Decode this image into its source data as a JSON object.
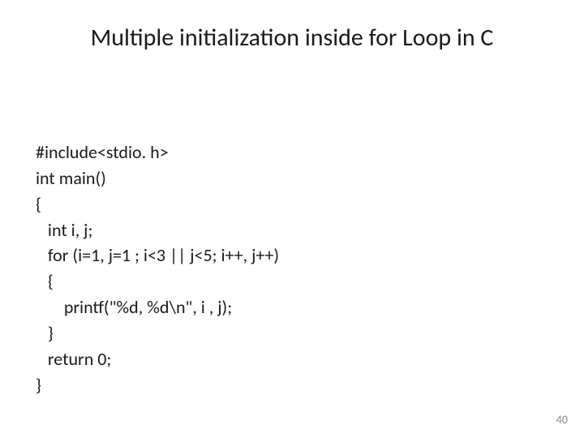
{
  "title": "Multiple initialization inside for Loop in C",
  "code": {
    "l1": "#include<stdio. h>",
    "l2": "int main()",
    "l3": "{",
    "l4": "   int i, j;",
    "l5": "   for (i=1, j=1 ; i<3 || j<5; i++, j++)",
    "l6": "   {",
    "l7": "       printf(\"%d, %d\\n\", i , j);",
    "l8": "   }",
    "l9": "   return 0;",
    "l10": "}"
  },
  "page_number": "40"
}
